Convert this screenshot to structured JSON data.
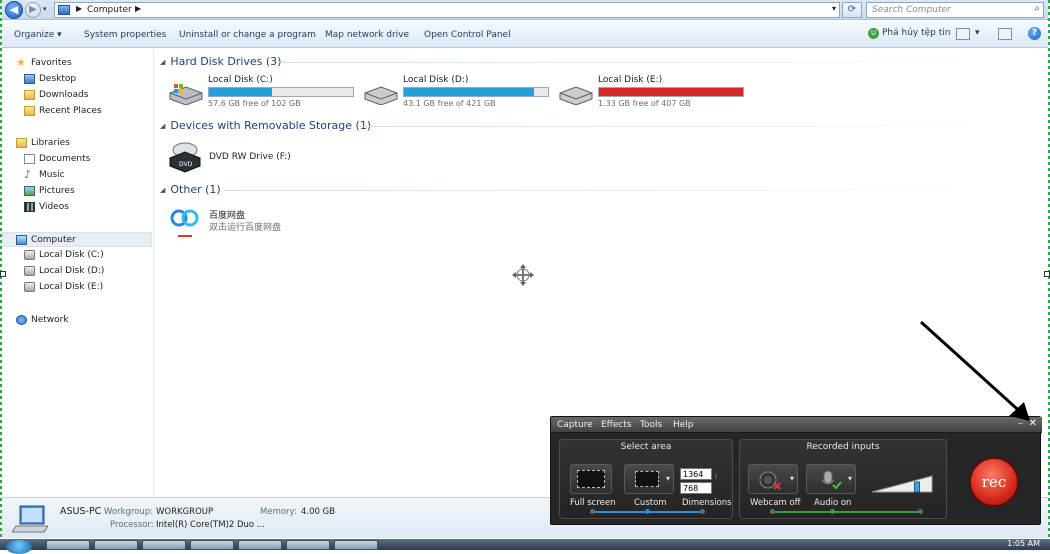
{
  "address": {
    "breadcrumb": "Computer",
    "search_placeholder": "Search Computer"
  },
  "toolbar": {
    "organize": "Organize ▾",
    "system_properties": "System properties",
    "uninstall": "Uninstall or change a program",
    "map_drive": "Map network drive",
    "control_panel": "Open Control Panel",
    "shred": "Phá hủy tệp tin",
    "help": "?"
  },
  "sidebar": {
    "favorites": "Favorites",
    "desktop": "Desktop",
    "downloads": "Downloads",
    "recent": "Recent Places",
    "libraries": "Libraries",
    "documents": "Documents",
    "music": "Music",
    "pictures": "Pictures",
    "videos": "Videos",
    "computer": "Computer",
    "disk_c": "Local Disk (C:)",
    "disk_d": "Local Disk (D:)",
    "disk_e": "Local Disk (E:)",
    "network": "Network"
  },
  "groups": {
    "hdd": "Hard Disk Drives (3)",
    "removable": "Devices with Removable Storage (1)",
    "other": "Other (1)"
  },
  "drives": [
    {
      "name": "Local Disk (C:)",
      "free": "57.6 GB free of 102 GB",
      "used_fraction": 0.44,
      "bar_color": "#26a0da"
    },
    {
      "name": "Local Disk (D:)",
      "free": "43.1 GB free of 421 GB",
      "used_fraction": 0.9,
      "bar_color": "#26a0da"
    },
    {
      "name": "Local Disk (E:)",
      "free": "1.33 GB free of 407 GB",
      "used_fraction": 0.997,
      "bar_color": "#da2626"
    }
  ],
  "dvd": {
    "label": "DVD RW Drive (F:)",
    "icon_text": "DVD"
  },
  "other_item": {
    "name": "百度网盘",
    "desc": "双击运行百度网盘"
  },
  "details": {
    "pc_name": "ASUS-PC",
    "workgroup_label": "Workgroup:",
    "workgroup": "WORKGROUP",
    "memory_label": "Memory:",
    "memory": "4.00 GB",
    "processor_label": "Processor:",
    "processor": "Intel(R) Core(TM)2 Duo ..."
  },
  "taskbar": {
    "clock": "1:05 AM"
  },
  "recorder": {
    "menu": [
      "Capture",
      "Effects",
      "Tools",
      "Help"
    ],
    "select_area_title": "Select area",
    "full_screen": "Full screen",
    "custom": "Custom",
    "dimensions": "Dimensions",
    "width": "1364",
    "height": "768",
    "recorded_inputs_title": "Recorded inputs",
    "webcam": "Webcam off",
    "audio": "Audio on",
    "rec_label": "rec",
    "audio_level": 0.75
  }
}
